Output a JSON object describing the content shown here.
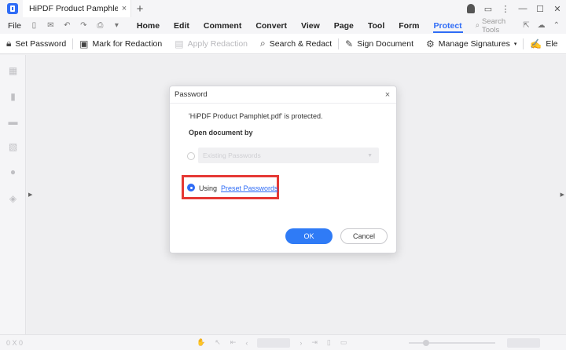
{
  "app": {
    "tab_title": "HiPDF Product Pamphlet.pdf",
    "tab_close": "×",
    "new_tab": "+",
    "window_controls": [
      "minimize-icon",
      "maximize-icon",
      "close-icon"
    ]
  },
  "menubar": {
    "file": "File",
    "items": [
      "Home",
      "Edit",
      "Comment",
      "Convert",
      "View",
      "Page",
      "Tool",
      "Form",
      "Protect"
    ],
    "active": "Protect",
    "search_tools": "Search Tools"
  },
  "ribbon": {
    "items": [
      {
        "label": "Set Password",
        "icon": "lock-icon",
        "enabled": true
      },
      {
        "label": "Mark for Redaction",
        "icon": "redaction-mark-icon",
        "enabled": true
      },
      {
        "label": "Apply Redaction",
        "icon": "apply-redaction-icon",
        "enabled": false
      },
      {
        "label": "Search & Redact",
        "icon": "search-redact-icon",
        "enabled": true
      },
      {
        "label": "Sign Document",
        "icon": "sign-icon",
        "enabled": true
      },
      {
        "label": "Manage Signatures",
        "icon": "manage-signatures-icon",
        "enabled": true
      },
      {
        "label": "Ele",
        "icon": "electronic-signature-icon",
        "enabled": true
      }
    ]
  },
  "dialog": {
    "title": "Password",
    "message": "'HiPDF Product Pamphlet.pdf' is protected.",
    "open_by_label": "Open document by",
    "existing_password_placeholder": "Existing Passwords",
    "using_label": "Using",
    "preset_link": "Preset Passwords",
    "ok": "OK",
    "cancel": "Cancel",
    "close": "×"
  },
  "statusbar": {
    "dims": "0 X 0"
  },
  "colors": {
    "accent": "#2f6cf6",
    "highlight": "#e53935"
  }
}
